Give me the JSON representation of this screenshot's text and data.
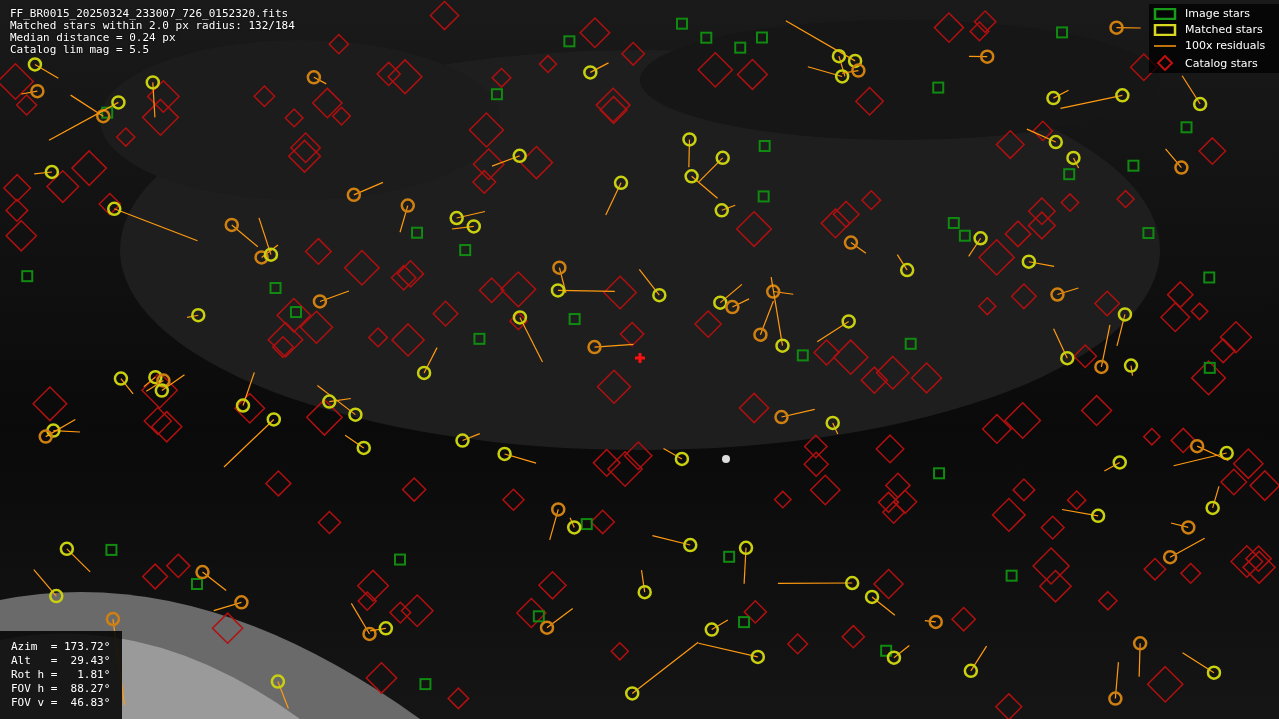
{
  "header_lines": [
    "FF_BR0015_20250324_233007_726_0152320.fits",
    "Matched stars within 2.0 px radius: 132/184",
    "Median distance = 0.24 px",
    "Catalog lim mag = 5.5"
  ],
  "legend": [
    {
      "label": "Image stars"
    },
    {
      "kind": "matched",
      "label": "Matched stars"
    },
    {
      "kind": "residual",
      "label": "100x residuals"
    },
    {
      "kind": "catalog",
      "label": "Catalog stars"
    }
  ],
  "pointing_info": [
    "Azim  = 173.72°",
    "Alt   =  29.43°",
    "Rot h =   1.81°",
    "FOV h =  88.27°",
    "FOV v =  46.83°"
  ]
}
